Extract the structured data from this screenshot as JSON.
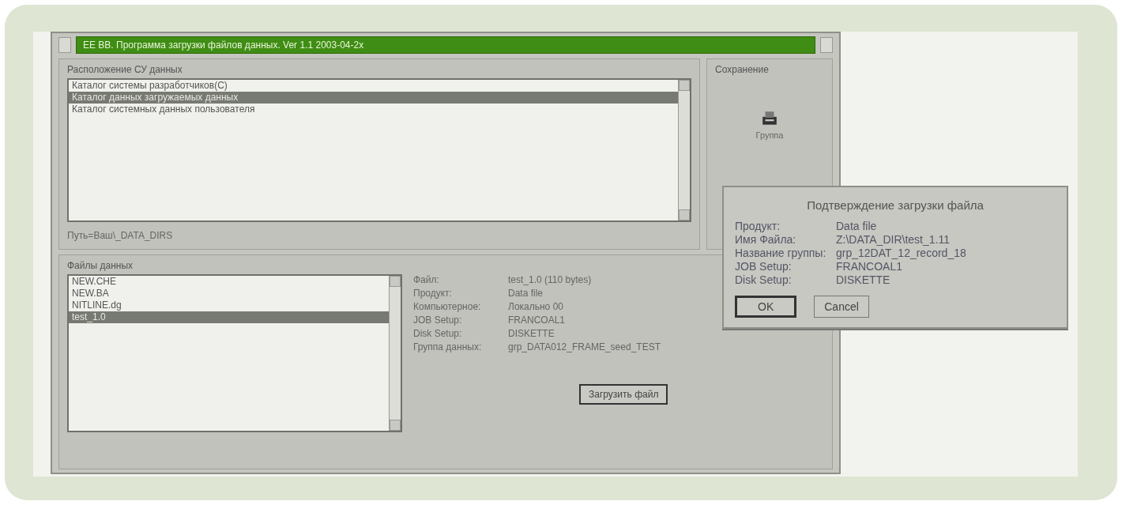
{
  "window": {
    "title": "ЕЕ ВВ. Программа загрузки файлов данных. Ver 1.1 2003-04-2x"
  },
  "catalogs": {
    "label": "Расположение СУ данных",
    "items": [
      {
        "text": "Каталог системы разработчиков(С)",
        "selected": false
      },
      {
        "text": "Каталог данных загружаемых данных",
        "selected": true
      },
      {
        "text": "Каталог системных данных пользователя",
        "selected": false
      }
    ],
    "path": "Путь=Ваш\\_DATA_DIRS"
  },
  "save": {
    "label": "Сохранение",
    "caption": "Группа"
  },
  "files": {
    "label": "Файлы данных",
    "items": [
      {
        "text": "NEW.CHE",
        "selected": false
      },
      {
        "text": "NEW.BA",
        "selected": false
      },
      {
        "text": "NITLINE.dg",
        "selected": false
      },
      {
        "text": "test_1.0",
        "selected": true
      }
    ],
    "details": [
      {
        "label": "Файл:",
        "value": "test_1.0 (110 bytes)"
      },
      {
        "label": "Продукт:",
        "value": "Data file"
      },
      {
        "label": "Компьютерное:",
        "value": "Локально 00"
      },
      {
        "label": "JOB Setup:",
        "value": "FRANCOAL1"
      },
      {
        "label": "Disk Setup:",
        "value": "DISKETTE"
      },
      {
        "label": "Группа данных:",
        "value": "grp_DATA012_FRAME_seed_TEST"
      }
    ],
    "button": "Загрузить файл"
  },
  "dialog": {
    "title": "Подтверждение загрузки файла",
    "rows": [
      {
        "label": "Продукт:",
        "value": "Data file"
      },
      {
        "label": "Имя Файла:",
        "value": "Z:\\DATA_DIR\\test_1.11"
      },
      {
        "label": "Название группы:",
        "value": "grp_12DAT_12_record_18"
      },
      {
        "label": "JOB Setup:",
        "value": "FRANCOAL1"
      },
      {
        "label": "Disk Setup:",
        "value": "DISKETTE"
      }
    ],
    "buttons": [
      {
        "label": "OK",
        "kind": "default"
      },
      {
        "label": "Cancel",
        "kind": "normal"
      }
    ]
  }
}
